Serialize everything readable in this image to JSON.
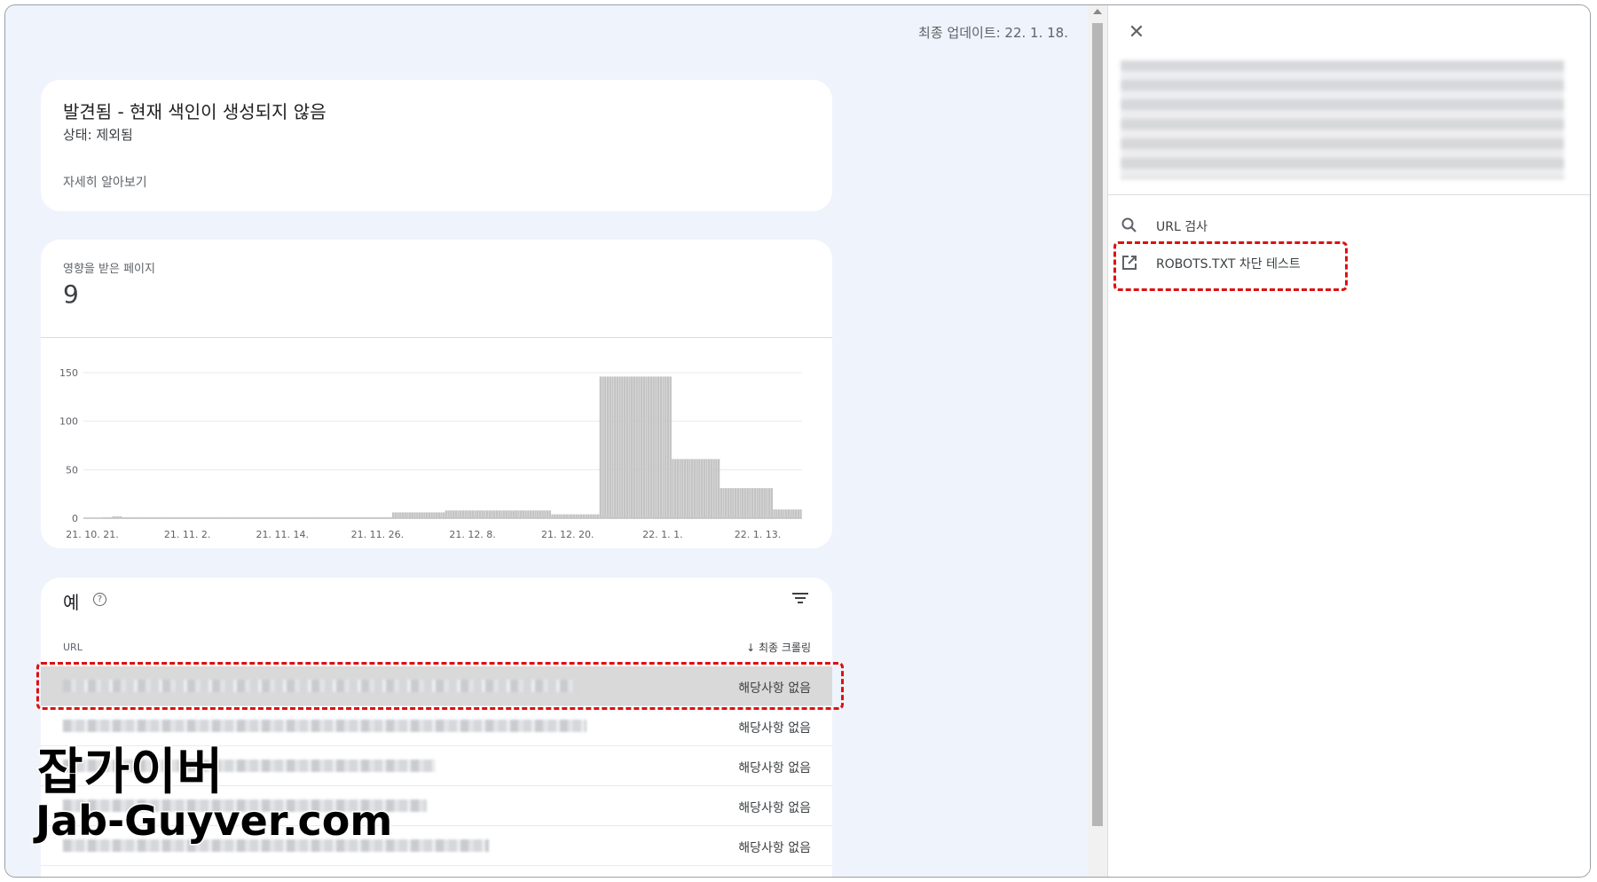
{
  "header": {
    "last_updated": "최종 업데이트: 22. 1. 18."
  },
  "issue_card": {
    "title": "발견됨 - 현재 색인이 생성되지 않음",
    "status": "상태: 제외됨",
    "learn_more": "자세히 알아보기"
  },
  "affected": {
    "label": "영향을 받은 페이지",
    "count": "9"
  },
  "chart_data": {
    "type": "bar",
    "ylim": [
      0,
      150
    ],
    "yticks": [
      "150",
      "100",
      "50",
      "0"
    ],
    "xtick_labels": [
      "21. 10. 21.",
      "21. 11. 2.",
      "21. 11. 14.",
      "21. 11. 26.",
      "21. 12. 8.",
      "21. 12. 20.",
      "22. 1. 1.",
      "22. 1. 13."
    ],
    "values": [
      0,
      0,
      0,
      0,
      0,
      0,
      0,
      0,
      1,
      1,
      1,
      1,
      2,
      2,
      2,
      2,
      1,
      1,
      1,
      1,
      1,
      1,
      1,
      1,
      1,
      1,
      1,
      1,
      1,
      1,
      1,
      1,
      1,
      1,
      1,
      1,
      1,
      1,
      1,
      1,
      1,
      1,
      1,
      1,
      1,
      1,
      1,
      1,
      1,
      1,
      1,
      1,
      1,
      1,
      1,
      1,
      1,
      1,
      1,
      1,
      1,
      1,
      1,
      1,
      1,
      1,
      1,
      1,
      1,
      1,
      1,
      1,
      1,
      1,
      1,
      1,
      1,
      1,
      1,
      1,
      1,
      1,
      1,
      1,
      1,
      1,
      1,
      1,
      1,
      1,
      1,
      1,
      1,
      1,
      1,
      1,
      1,
      1,
      1,
      1,
      1,
      1,
      1,
      1,
      1,
      1,
      1,
      1,
      1,
      1,
      1,
      1,
      1,
      1,
      1,
      1,
      1,
      1,
      1,
      1,
      1,
      1,
      1,
      1,
      1,
      1,
      1,
      1,
      6,
      6,
      6,
      6,
      6,
      6,
      6,
      6,
      6,
      6,
      6,
      6,
      6,
      6,
      6,
      6,
      6,
      6,
      6,
      6,
      6,
      6,
      8,
      8,
      8,
      8,
      8,
      8,
      8,
      8,
      8,
      8,
      8,
      8,
      8,
      8,
      8,
      8,
      8,
      8,
      8,
      8,
      8,
      8,
      8,
      8,
      8,
      8,
      8,
      8,
      8,
      8,
      8,
      8,
      8,
      8,
      8,
      8,
      8,
      8,
      8,
      8,
      8,
      8,
      8,
      8,
      4,
      4,
      4,
      4,
      4,
      4,
      4,
      4,
      4,
      4,
      4,
      4,
      4,
      4,
      4,
      4,
      4,
      4,
      4,
      4,
      146,
      146,
      146,
      146,
      146,
      146,
      146,
      146,
      146,
      146,
      146,
      146,
      146,
      146,
      146,
      146,
      146,
      146,
      146,
      146,
      146,
      146,
      146,
      146,
      146,
      146,
      146,
      146,
      146,
      146,
      61,
      61,
      61,
      61,
      61,
      61,
      61,
      61,
      61,
      61,
      61,
      61,
      61,
      61,
      61,
      61,
      61,
      61,
      61,
      61,
      31,
      31,
      31,
      31,
      31,
      31,
      31,
      31,
      31,
      31,
      31,
      31,
      31,
      31,
      31,
      31,
      31,
      31,
      31,
      31,
      31,
      31,
      9,
      9,
      9,
      9,
      9,
      9,
      9,
      9,
      9,
      9,
      9,
      9
    ],
    "color": "#c4c4c4"
  },
  "examples": {
    "title": "예",
    "help": "?",
    "col_url": "URL",
    "col_crawl": "↓ 최종 크롤링",
    "rows": [
      {
        "value": "해당사항 없음"
      },
      {
        "value": "해당사항 없음"
      },
      {
        "value": "해당사항 없음"
      },
      {
        "value": "해당사항 없음"
      },
      {
        "value": "해당사항 없음"
      }
    ]
  },
  "panel": {
    "close_icon": "✕",
    "actions": [
      {
        "label": "URL 검사",
        "icon": "search-icon"
      },
      {
        "label": "ROBOTS.TXT 차단 테스트",
        "icon": "open-in-new-icon"
      }
    ]
  },
  "watermark": {
    "korean": "잡가이버",
    "domain": "Jab-Guyver.com"
  },
  "colors": {
    "highlight": "#dd1111",
    "background": "#eff3fb",
    "bar": "#c4c4c4"
  }
}
